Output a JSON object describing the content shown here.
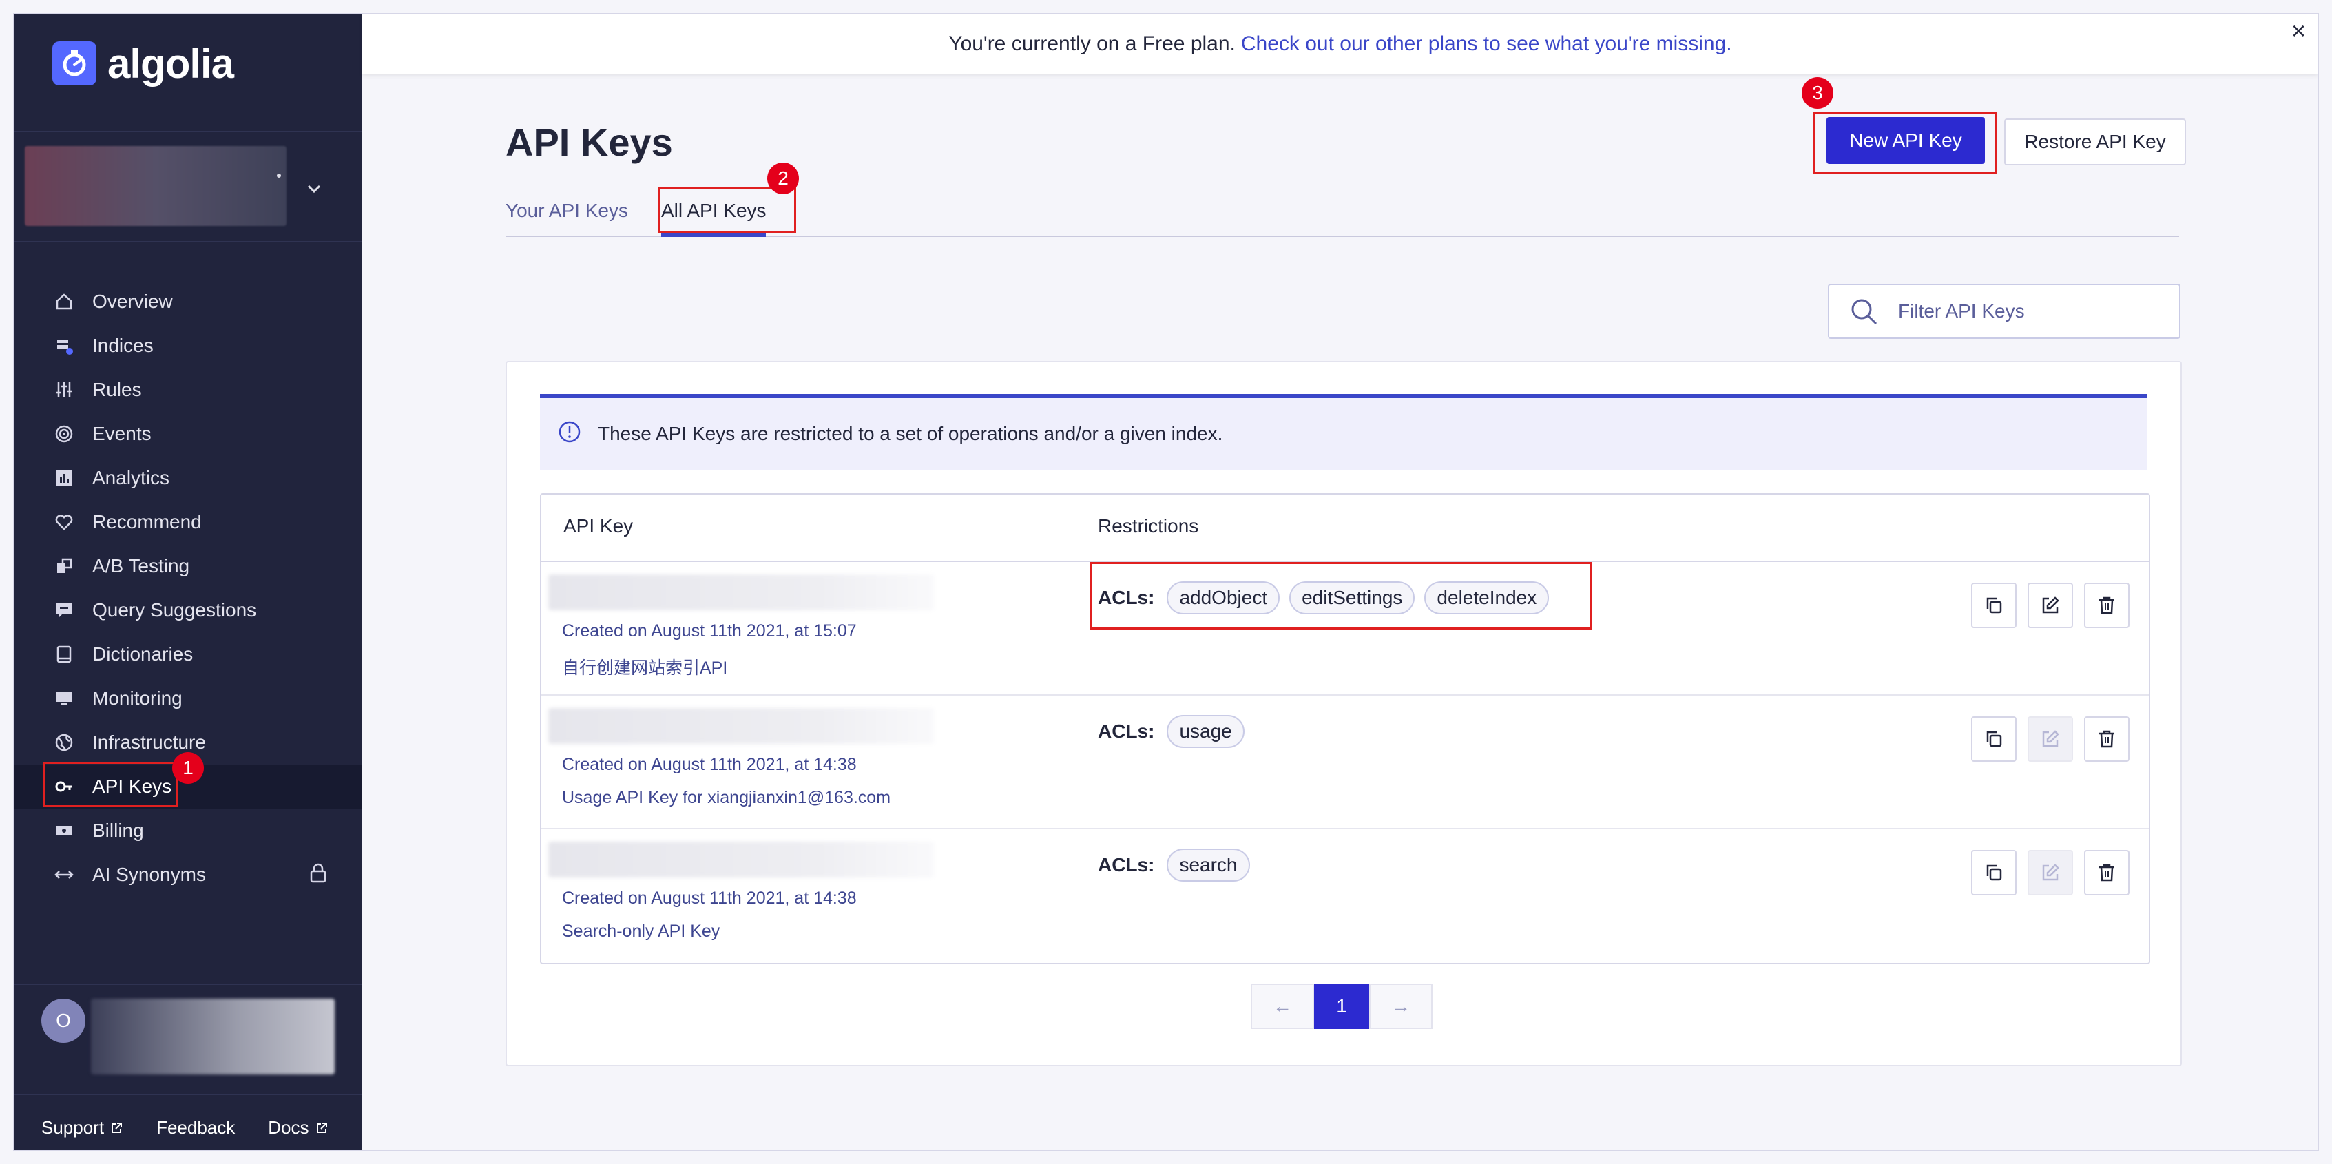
{
  "brand": {
    "name": "algolia",
    "accent": "#5468ff"
  },
  "banner": {
    "text": "You're currently on a Free plan.",
    "link": "Check out our other plans to see what you're missing.",
    "close": "×"
  },
  "sidebar": {
    "items": [
      {
        "label": "Overview",
        "icon": "home-icon"
      },
      {
        "label": "Indices",
        "icon": "indices-icon"
      },
      {
        "label": "Rules",
        "icon": "sliders-icon"
      },
      {
        "label": "Events",
        "icon": "target-icon"
      },
      {
        "label": "Analytics",
        "icon": "analytics-icon"
      },
      {
        "label": "Recommend",
        "icon": "heart-icon"
      },
      {
        "label": "A/B Testing",
        "icon": "ab-test-icon"
      },
      {
        "label": "Query Suggestions",
        "icon": "chat-icon"
      },
      {
        "label": "Dictionaries",
        "icon": "book-icon"
      },
      {
        "label": "Monitoring",
        "icon": "monitor-icon"
      },
      {
        "label": "Infrastructure",
        "icon": "globe-icon"
      },
      {
        "label": "API Keys",
        "icon": "key-icon",
        "active": true
      },
      {
        "label": "Billing",
        "icon": "billing-icon"
      },
      {
        "label": "AI Synonyms",
        "icon": "arrows-icon",
        "locked": true
      }
    ],
    "user_initial": "O",
    "footer": {
      "support": "Support",
      "feedback": "Feedback",
      "docs": "Docs"
    }
  },
  "page": {
    "title": "API Keys",
    "tabs": [
      {
        "label": "Your API Keys"
      },
      {
        "label": "All API Keys",
        "active": true
      }
    ],
    "new_key_button": "New API Key",
    "restore_key_button": "Restore API Key",
    "filter_placeholder": "Filter API Keys",
    "info_text": "These API Keys are restricted to a set of operations and/or a given index.",
    "columns": {
      "key": "API Key",
      "restrictions": "Restrictions"
    },
    "acl_label": "ACLs:",
    "rows": [
      {
        "created": "Created on August 11th 2021, at 15:07",
        "description": "自行创建网站索引API",
        "acls": [
          "addObject",
          "editSettings",
          "deleteIndex"
        ],
        "edit_enabled": true
      },
      {
        "created": "Created on August 11th 2021, at 14:38",
        "description": "Usage API Key for xiangjianxin1@163.com",
        "acls": [
          "usage"
        ],
        "edit_enabled": false
      },
      {
        "created": "Created on August 11th 2021, at 14:38",
        "description": "Search-only API Key",
        "acls": [
          "search"
        ],
        "edit_enabled": false
      }
    ],
    "pagination": {
      "prev": "←",
      "current": "1",
      "next": "→"
    }
  },
  "annotations": {
    "one": "1",
    "two": "2",
    "three": "3"
  }
}
